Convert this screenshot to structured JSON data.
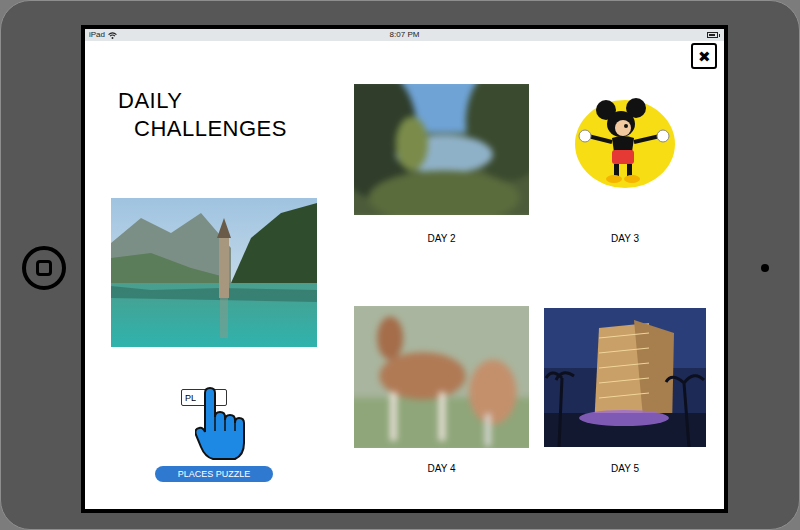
{
  "status_bar": {
    "device": "iPad",
    "time": "8:07 PM",
    "battery_level": 0.85
  },
  "close_button": "✖",
  "title": [
    "DAILY",
    "CHALLENGES"
  ],
  "featured": {
    "button_text": "PL",
    "label": "PLACES PUZZLE"
  },
  "days": [
    {
      "label": "DAY 2",
      "locked": true
    },
    {
      "label": "DAY 3",
      "locked": false
    },
    {
      "label": "DAY 4",
      "locked": true
    },
    {
      "label": "DAY 5",
      "locked": false
    }
  ]
}
